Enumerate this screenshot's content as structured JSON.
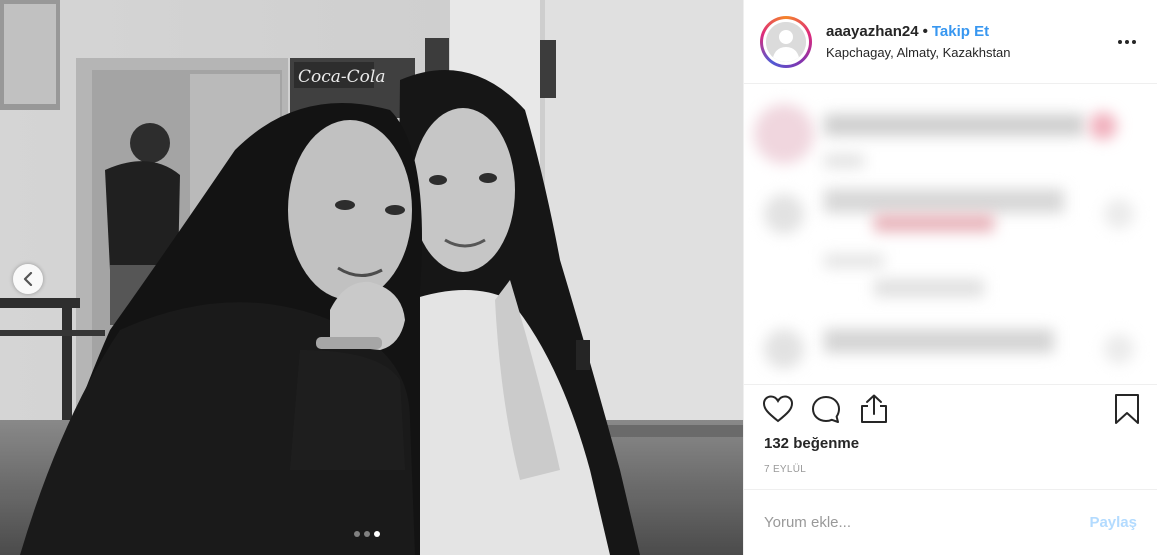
{
  "header": {
    "username": "aaayazhan24",
    "separator": "•",
    "follow_label": "Takip Et",
    "location": "Kapchagay, Almaty, Kazakhstan"
  },
  "photo": {
    "carousel_dots": 3,
    "active_dot": 3,
    "sign_text": "Coca-Cola"
  },
  "actions": {
    "icons": [
      "heart-icon",
      "comment-icon",
      "share-icon",
      "bookmark-icon"
    ]
  },
  "likes_text": "132 beğenme",
  "date_text": "7 EYLÜL",
  "comment": {
    "placeholder": "Yorum ekle...",
    "submit_label": "Paylaş"
  },
  "colors": {
    "link": "#3897f0",
    "submit_disabled": "#b3dbff",
    "text": "#262626",
    "muted": "#999999"
  }
}
